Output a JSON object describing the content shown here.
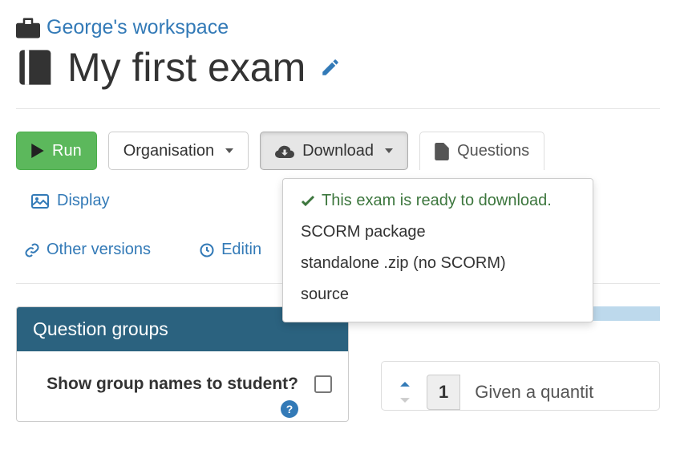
{
  "workspace": {
    "name": "George's workspace"
  },
  "exam": {
    "title": "My first exam"
  },
  "toolbar": {
    "run": "Run",
    "organisation": "Organisation",
    "download": "Download",
    "questions": "Questions",
    "display": "Display"
  },
  "secondary": {
    "other_versions": "Other versions",
    "editing_history": "Editin"
  },
  "download_menu": {
    "ready": "This exam is ready to download.",
    "items": [
      "SCORM package",
      "standalone .zip (no SCORM)",
      "source"
    ]
  },
  "panel": {
    "title": "Question groups",
    "show_group_names": "Show group names to student?"
  },
  "right": {
    "strip_color": "#bdd9ec",
    "question_number": "1",
    "question_text": "Given a quantit"
  },
  "colors": {
    "link": "#337ab7",
    "run": "#5cb85c",
    "panel_header": "#2b627f",
    "success": "#3c763d"
  }
}
